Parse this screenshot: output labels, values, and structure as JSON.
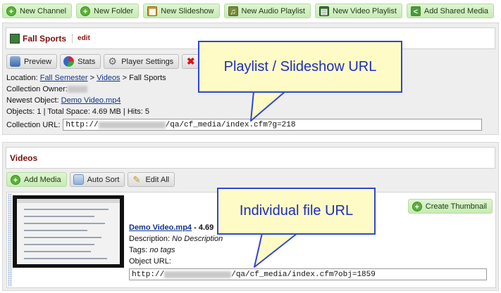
{
  "toolbar": {
    "new_channel": "New Channel",
    "new_folder": "New Folder",
    "new_slideshow": "New Slideshow",
    "new_audio_playlist": "New Audio Playlist",
    "new_video_playlist": "New Video Playlist",
    "add_shared_media": "Add Shared Media"
  },
  "collection": {
    "title": "Fall Sports",
    "edit": "edit",
    "tabs": {
      "preview": "Preview",
      "stats": "Stats",
      "player_settings": "Player Settings"
    },
    "location_label": "Location:",
    "location_sep1": " > ",
    "location_link1": "Fall Semester",
    "location_sep2": " > ",
    "location_link2": "Videos",
    "location_tail": " > Fall Sports",
    "owner_label": "Collection Owner:",
    "newest_label": "Newest Object:",
    "newest_link": "Demo Video.mp4",
    "stats_line": "Objects: 1 | Total Space: 4.69 MB | Hits: 5",
    "url_label": "Collection URL:",
    "url_prefix": "http://",
    "url_suffix": "/qa/cf_media/index.cfm?g=218"
  },
  "videos": {
    "title": "Videos",
    "add_media": "Add Media",
    "auto_sort": "Auto Sort",
    "edit_all": "Edit All",
    "create_thumbnail": "Create Thumbnail",
    "item": {
      "name": "Demo Video.mp4",
      "size": " - 4.69",
      "description_label": "Description:",
      "description_value": "No Description",
      "tags_label": "Tags:",
      "tags_value": "no tags",
      "object_url_label": "Object URL:",
      "url_prefix": "http://",
      "url_suffix": "/qa/cf_media/index.cfm?obj=1859"
    }
  },
  "callouts": {
    "playlist": "Playlist / Slideshow URL",
    "file": "Individual file URL"
  },
  "colors": {
    "callout_fill": "#fffbc7",
    "callout_border": "#2f47d0",
    "green_button": "#c7ebb5",
    "title_red": "#7a0e0e"
  }
}
